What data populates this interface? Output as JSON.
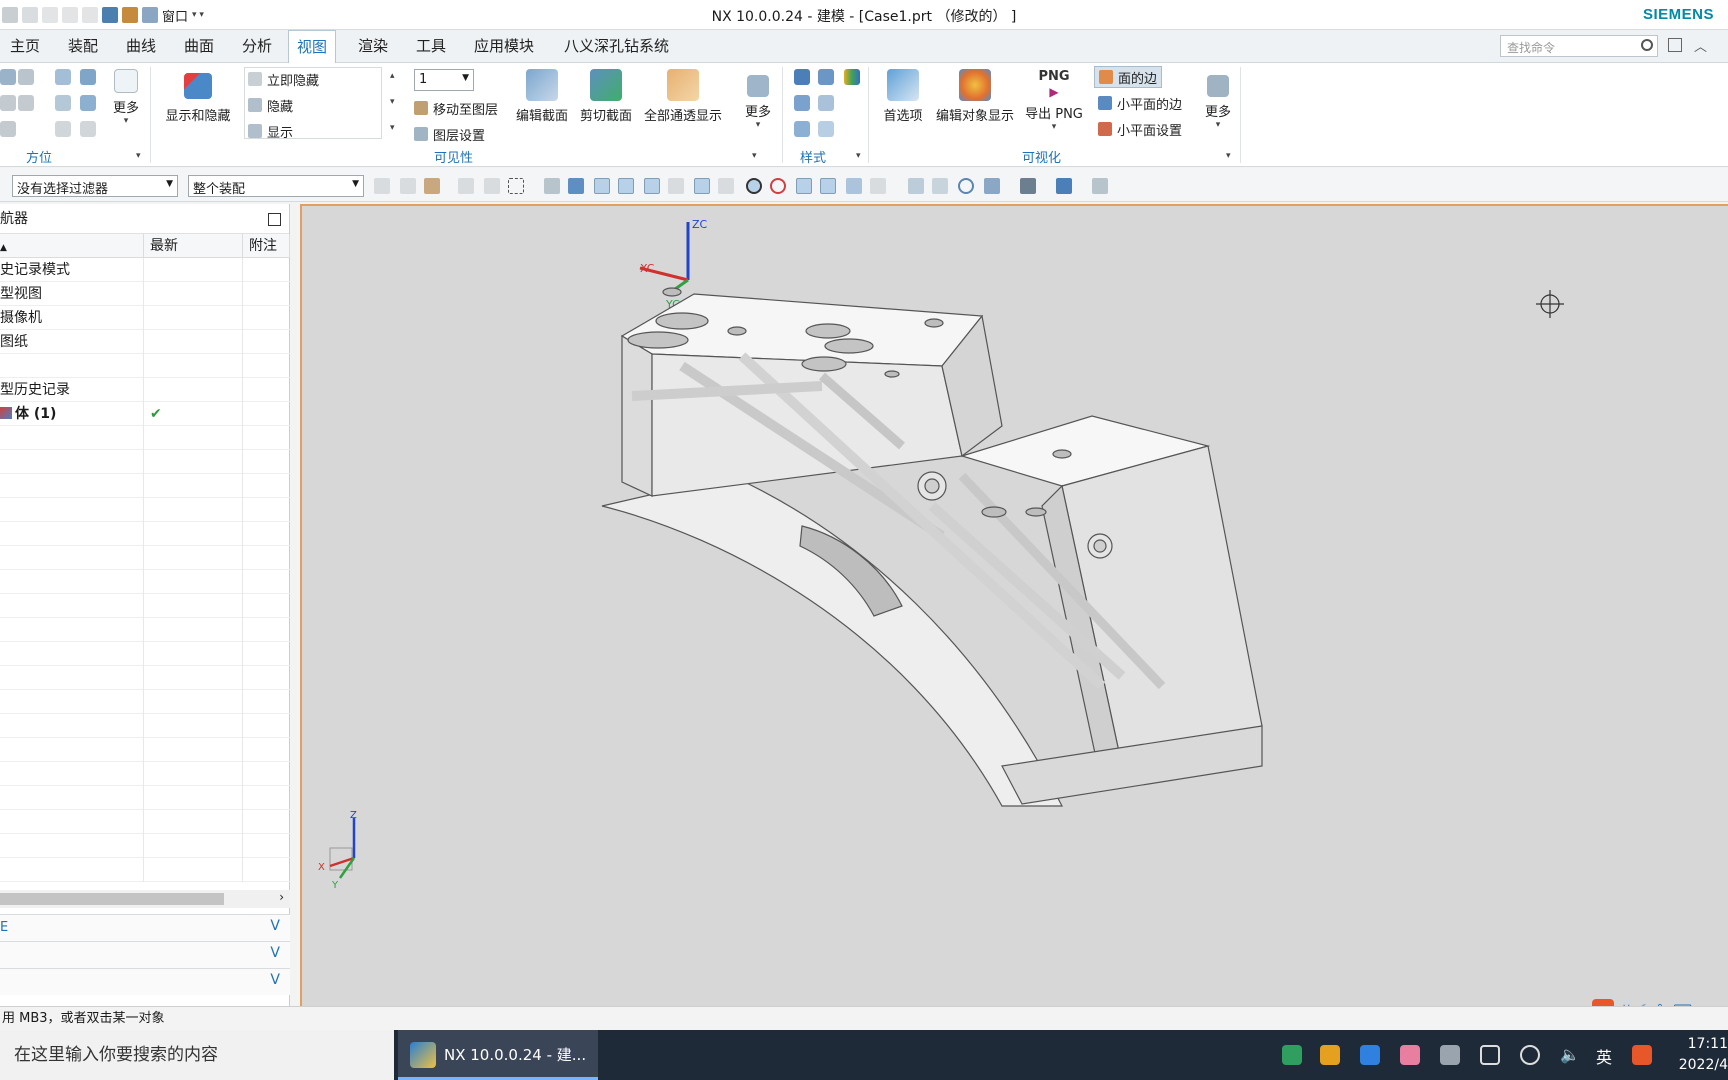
{
  "window": {
    "title": "NX 10.0.0.24 - 建模 - [Case1.prt （修改的） ]",
    "brand": "SIEMENS",
    "quick_window_label": "窗口"
  },
  "menu": {
    "tabs": [
      "主页",
      "装配",
      "曲线",
      "曲面",
      "分析",
      "视图",
      "渲染",
      "工具",
      "应用模块",
      "八义深孔钻系统"
    ],
    "active_tab": "视图",
    "search_placeholder": "查找命令"
  },
  "ribbon": {
    "orientation_group": "方位",
    "more_label": "更多",
    "show_hide_label": "显示和隐藏",
    "instant_hide": "立即隐藏",
    "hide": "隐藏",
    "show": "显示",
    "layer_value": "1",
    "move_to_layer": "移动至图层",
    "layer_settings": "图层设置",
    "edit_section": "编辑截面",
    "clip_section": "剪切截面",
    "all_pass_display": "全部通透显示",
    "visibility_group": "可见性",
    "style_group": "样式",
    "preferences": "首选项",
    "edit_object_display": "编辑对象显示",
    "export_png": "导出 PNG",
    "png_label": "PNG",
    "face_edges": "面的边",
    "facet_edges": "小平面的边",
    "facet_settings": "小平面设置",
    "visualization_group": "可视化"
  },
  "selection_bar": {
    "filter": "没有选择过滤器",
    "scope": "整个装配"
  },
  "navigator": {
    "title": "航器",
    "columns": [
      "",
      "最新",
      "附注"
    ],
    "rows": [
      {
        "name": "史记录模式",
        "latest": ""
      },
      {
        "name": "型视图",
        "latest": ""
      },
      {
        "name": "摄像机",
        "latest": ""
      },
      {
        "name": "图纸",
        "latest": ""
      },
      {
        "name": "",
        "latest": ""
      },
      {
        "name": "型历史记录",
        "latest": ""
      },
      {
        "name": "体 (1)",
        "latest": "✔"
      }
    ],
    "panel1": "E"
  },
  "viewport": {
    "axis_zc": "ZC",
    "axis_xc": "XC",
    "axis_yc": "YC",
    "triad_z": "Z",
    "triad_x": "X",
    "triad_y": "Y"
  },
  "status": {
    "message": "用 MB3，或者双击某一对象"
  },
  "taskbar": {
    "search_placeholder": "在这里输入你要搜索的内容",
    "app_label": "NX 10.0.0.24 - 建...",
    "time": "17:11",
    "date": "2022/4",
    "lang": "英"
  },
  "colors": {
    "accent": "#1e73b8",
    "brand": "#008aa8",
    "viewport_bg": "#d7d7d7",
    "viewport_border": "#e0a060"
  }
}
